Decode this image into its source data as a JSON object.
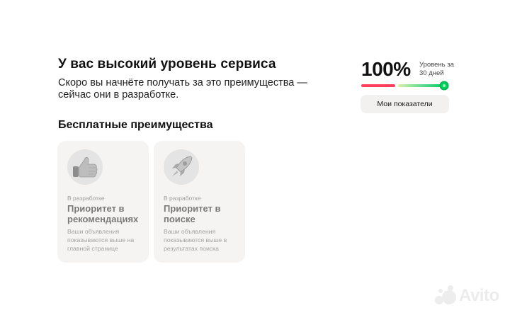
{
  "header": {
    "title": "У вас высокий уровень сервиса",
    "subtitle": "Скоро вы начнёте получать за это преимущества — сейчас они в разработке."
  },
  "metric": {
    "value": "100%",
    "label": "Уровень за 30 дней",
    "level_fraction": 1.0,
    "button_label": "Мои показатели",
    "colors": {
      "low": "#ff3e5c",
      "high": "#02d15c"
    }
  },
  "benefits": {
    "section_title": "Бесплатные преимущества",
    "cards": [
      {
        "status": "В разработке",
        "title": "Приоритет в рекомендациях",
        "description": "Ваши объявления показываются выше на главной странице",
        "icon": "thumbs-up-icon"
      },
      {
        "status": "В разработке",
        "title": "Приоритет в поиске",
        "description": "Ваши объявления показываются выше в результатах поиска",
        "icon": "rocket-icon"
      }
    ]
  },
  "watermark": {
    "text": "Avito"
  }
}
